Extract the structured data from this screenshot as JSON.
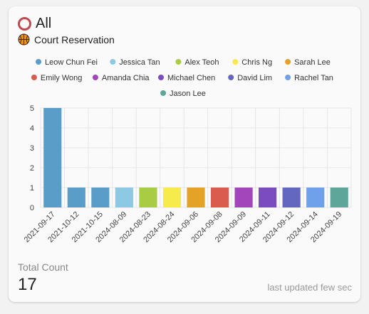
{
  "header": {
    "title": "All",
    "subtitle": "Court Reservation"
  },
  "footer": {
    "total_label": "Total Count",
    "total_value": "17",
    "updated_text": "last updated few sec"
  },
  "colors": {
    "ring": "#c0484f",
    "grid": "#e6e6e6"
  },
  "icons": {
    "title": "circle-outline-icon",
    "subtitle": "basketball-icon"
  },
  "chart_data": {
    "type": "bar",
    "categories": [
      "2021-09-17",
      "2021-10-12",
      "2021-10-15",
      "2024-08-09",
      "2024-08-23",
      "2024-08-24",
      "2024-09-06",
      "2024-09-08",
      "2024-09-09",
      "2024-09-11",
      "2024-09-12",
      "2024-09-14",
      "2024-09-19"
    ],
    "series": [
      {
        "name": "Leow Chun Fei",
        "color": "#5b9dc9",
        "values": [
          5,
          1,
          1,
          0,
          0,
          0,
          0,
          0,
          0,
          0,
          0,
          0,
          0
        ]
      },
      {
        "name": "Jessica Tan",
        "color": "#8ec9e3",
        "values": [
          0,
          0,
          0,
          1,
          0,
          0,
          0,
          0,
          0,
          0,
          0,
          0,
          0
        ]
      },
      {
        "name": "Alex Teoh",
        "color": "#a8cc44",
        "values": [
          0,
          0,
          0,
          0,
          1,
          0,
          0,
          0,
          0,
          0,
          0,
          0,
          0
        ]
      },
      {
        "name": "Chris Ng",
        "color": "#f6eb4a",
        "values": [
          0,
          0,
          0,
          0,
          0,
          1,
          0,
          0,
          0,
          0,
          0,
          0,
          0
        ]
      },
      {
        "name": "Sarah Lee",
        "color": "#e4a226",
        "values": [
          0,
          0,
          0,
          0,
          0,
          0,
          1,
          0,
          0,
          0,
          0,
          0,
          0
        ]
      },
      {
        "name": "Emily Wong",
        "color": "#d95c4f",
        "values": [
          0,
          0,
          0,
          0,
          0,
          0,
          0,
          1,
          0,
          0,
          0,
          0,
          0
        ]
      },
      {
        "name": "Amanda Chia",
        "color": "#a446bb",
        "values": [
          0,
          0,
          0,
          0,
          0,
          0,
          0,
          0,
          1,
          0,
          0,
          0,
          0
        ]
      },
      {
        "name": "Michael Chen",
        "color": "#7b4cbf",
        "values": [
          0,
          0,
          0,
          0,
          0,
          0,
          0,
          0,
          0,
          1,
          0,
          0,
          0
        ]
      },
      {
        "name": "David Lim",
        "color": "#6367bf",
        "values": [
          0,
          0,
          0,
          0,
          0,
          0,
          0,
          0,
          0,
          0,
          1,
          0,
          0
        ]
      },
      {
        "name": "Rachel Tan",
        "color": "#6ea1ea",
        "values": [
          0,
          0,
          0,
          0,
          0,
          0,
          0,
          0,
          0,
          0,
          0,
          1,
          0
        ]
      },
      {
        "name": "Jason Lee",
        "color": "#5ea59a",
        "values": [
          0,
          0,
          0,
          0,
          0,
          0,
          0,
          0,
          0,
          0,
          0,
          0,
          1
        ]
      }
    ],
    "yticks": [
      0,
      1,
      2,
      3,
      4,
      5
    ],
    "ylim": [
      0,
      5
    ],
    "stacked": true,
    "legend_position": "top-center",
    "grid": true
  }
}
